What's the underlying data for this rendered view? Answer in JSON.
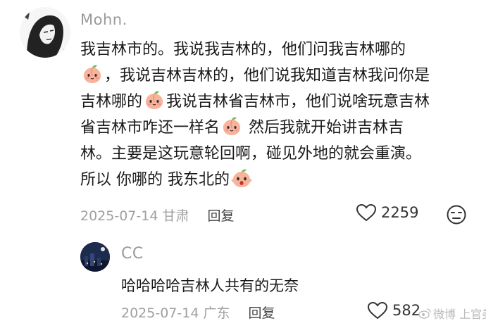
{
  "comment": {
    "author": "Mohn.",
    "lines": [
      [
        "我吉林市的。我说我吉林的，他们问我吉林哪的"
      ],
      [
        "",
        "，我说吉林吉林的，他们说我知道吉林我问你是"
      ],
      [
        "吉林哪的",
        "我说吉林省吉林市，他们说啥玩意吉林"
      ],
      [
        "省吉林市咋还一样名",
        " 然后我就开始讲吉林吉"
      ],
      [
        "林。主要是这玩意轮回啊，碰见外地的就会重演。"
      ],
      [
        "所以 你哪的 我东北的",
        ""
      ]
    ],
    "date": "2025-07-14",
    "location": "甘肃",
    "reply_label": "回复",
    "likes": "2259"
  },
  "reply": {
    "author": "CC",
    "text": "哈哈哈哈吉林人共有的无奈",
    "date": "2025-07-14",
    "location": "广东",
    "reply_label": "回复",
    "likes": "582"
  },
  "watermark": "微博 上官美娱",
  "colors": {
    "muted": "#9a9a9a",
    "text": "#1a1a1a",
    "peach": "#f4a48c",
    "leaf": "#6bbf4e"
  },
  "icons": [
    "peach-emoji-icon",
    "heart-outline-icon",
    "dislike-face-icon",
    "weibo-logo-icon"
  ]
}
